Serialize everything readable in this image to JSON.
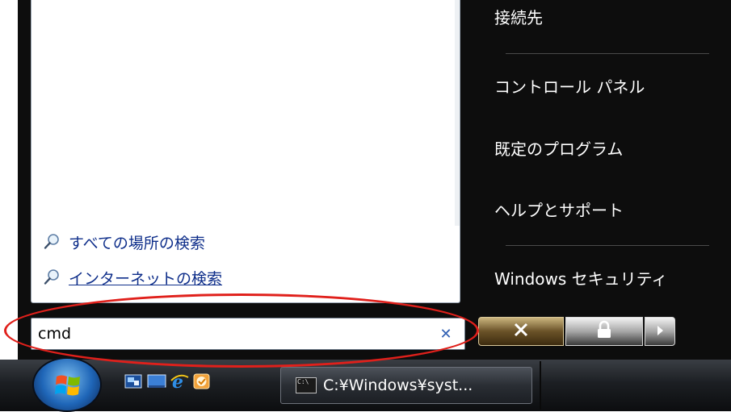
{
  "start_menu": {
    "search_links": [
      {
        "label": "すべての場所の検索",
        "icon": "search-icon"
      },
      {
        "label": "インターネットの検索",
        "icon": "search-icon"
      }
    ],
    "right_items": [
      {
        "label": "接続先"
      },
      {
        "label": "コントロール パネル"
      },
      {
        "label": "既定のプログラム"
      },
      {
        "label": "ヘルプとサポート"
      },
      {
        "label": "Windows セキュリティ"
      }
    ],
    "search_box": {
      "value": "cmd",
      "clear_icon": "close-icon"
    },
    "power_buttons": {
      "shutdown_icon": "close-icon",
      "lock_icon": "lock-icon",
      "more_icon": "triangle-right-icon"
    }
  },
  "taskbar": {
    "start_button": "windows-logo-icon",
    "quick_launch": [
      "show-desktop-icon",
      "switch-windows-icon",
      "internet-explorer-icon",
      "outlook-icon"
    ],
    "window_button": {
      "label": "C:¥Windows¥syst...",
      "icon": "command-prompt-icon"
    }
  },
  "annotation": {
    "color": "#e0201b"
  },
  "colors": {
    "menu_dark": "#0d0d0d",
    "link_blue": "#0e2e8a",
    "power_amber": "#6a5228"
  }
}
